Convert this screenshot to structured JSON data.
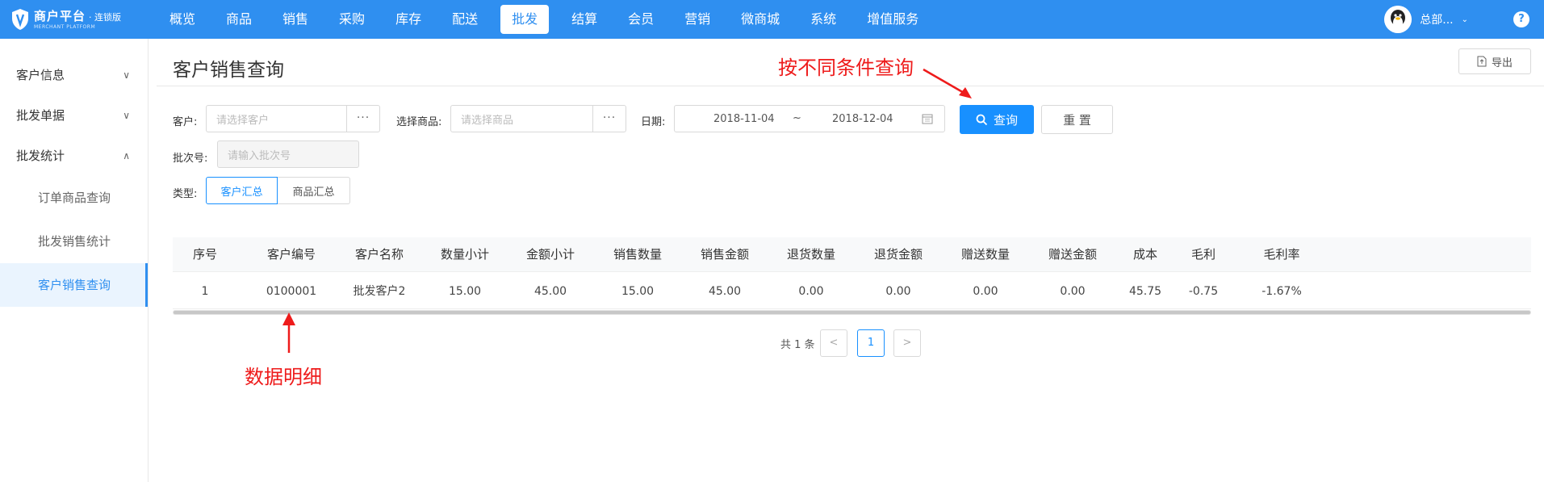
{
  "brand": {
    "title": "商户平台",
    "edition": "· 连锁版",
    "subtitle": "MERCHANT PLATFORM"
  },
  "nav": {
    "items": [
      "概览",
      "商品",
      "销售",
      "采购",
      "库存",
      "配送",
      "批发",
      "结算",
      "会员",
      "营销",
      "微商城",
      "系统",
      "增值服务"
    ],
    "active_index": 6
  },
  "user": {
    "name": "总部..."
  },
  "sidebar": {
    "groups": [
      {
        "label": "客户信息",
        "expanded": false
      },
      {
        "label": "批发单据",
        "expanded": false
      },
      {
        "label": "批发统计",
        "expanded": true
      }
    ],
    "subitems": [
      "订单商品查询",
      "批发销售统计",
      "客户销售查询"
    ],
    "active_sub": "客户销售查询"
  },
  "page": {
    "title": "客户销售查询",
    "export_label": "导出"
  },
  "filters": {
    "customer_label": "客户:",
    "customer_placeholder": "请选择客户",
    "goods_label": "选择商品:",
    "goods_placeholder": "请选择商品",
    "date_label": "日期:",
    "date_start": "2018-11-04",
    "date_sep": "~",
    "date_end": "2018-12-04",
    "batch_label": "批次号:",
    "batch_placeholder": "请输入批次号",
    "type_label": "类型:",
    "type_options": [
      "客户汇总",
      "商品汇总"
    ],
    "type_selected": "客户汇总",
    "query_label": "查询",
    "reset_label": "重 置",
    "more_glyph": "···"
  },
  "table": {
    "columns": [
      "序号",
      "客户编号",
      "客户名称",
      "数量小计",
      "金额小计",
      "销售数量",
      "销售金额",
      "退货数量",
      "退货金额",
      "赠送数量",
      "赠送金额",
      "成本",
      "毛利",
      "毛利率"
    ],
    "rows": [
      [
        "1",
        "0100001",
        "批发客户2",
        "15.00",
        "45.00",
        "15.00",
        "45.00",
        "0.00",
        "0.00",
        "0.00",
        "0.00",
        "45.75",
        "-0.75",
        "-1.67%"
      ]
    ]
  },
  "pagination": {
    "total_text": "共 1 条",
    "current_page": "1",
    "prev": "<",
    "next": ">"
  },
  "annotations": {
    "top": "按不同条件查询",
    "bottom": "数据明细"
  },
  "colors": {
    "primary": "#2f8ff0",
    "button": "#1890ff",
    "annotation": "#ee1b1b"
  }
}
